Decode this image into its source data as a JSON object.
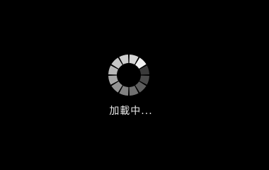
{
  "loading": {
    "text": "加載中...",
    "spinner_icon": "loading-spinner-icon",
    "segment_shades": [
      "#d6d6d6",
      "#f2f2f2",
      "#3a3a3a",
      "#4a4a4a",
      "#5e5e5e",
      "#707070",
      "#828282",
      "#949494",
      "#a6a6a6",
      "#b8b8b8",
      "#c6c6c6",
      "#cfcfcf"
    ]
  },
  "colors": {
    "background": "#000000",
    "text": "#e8e8e8"
  }
}
